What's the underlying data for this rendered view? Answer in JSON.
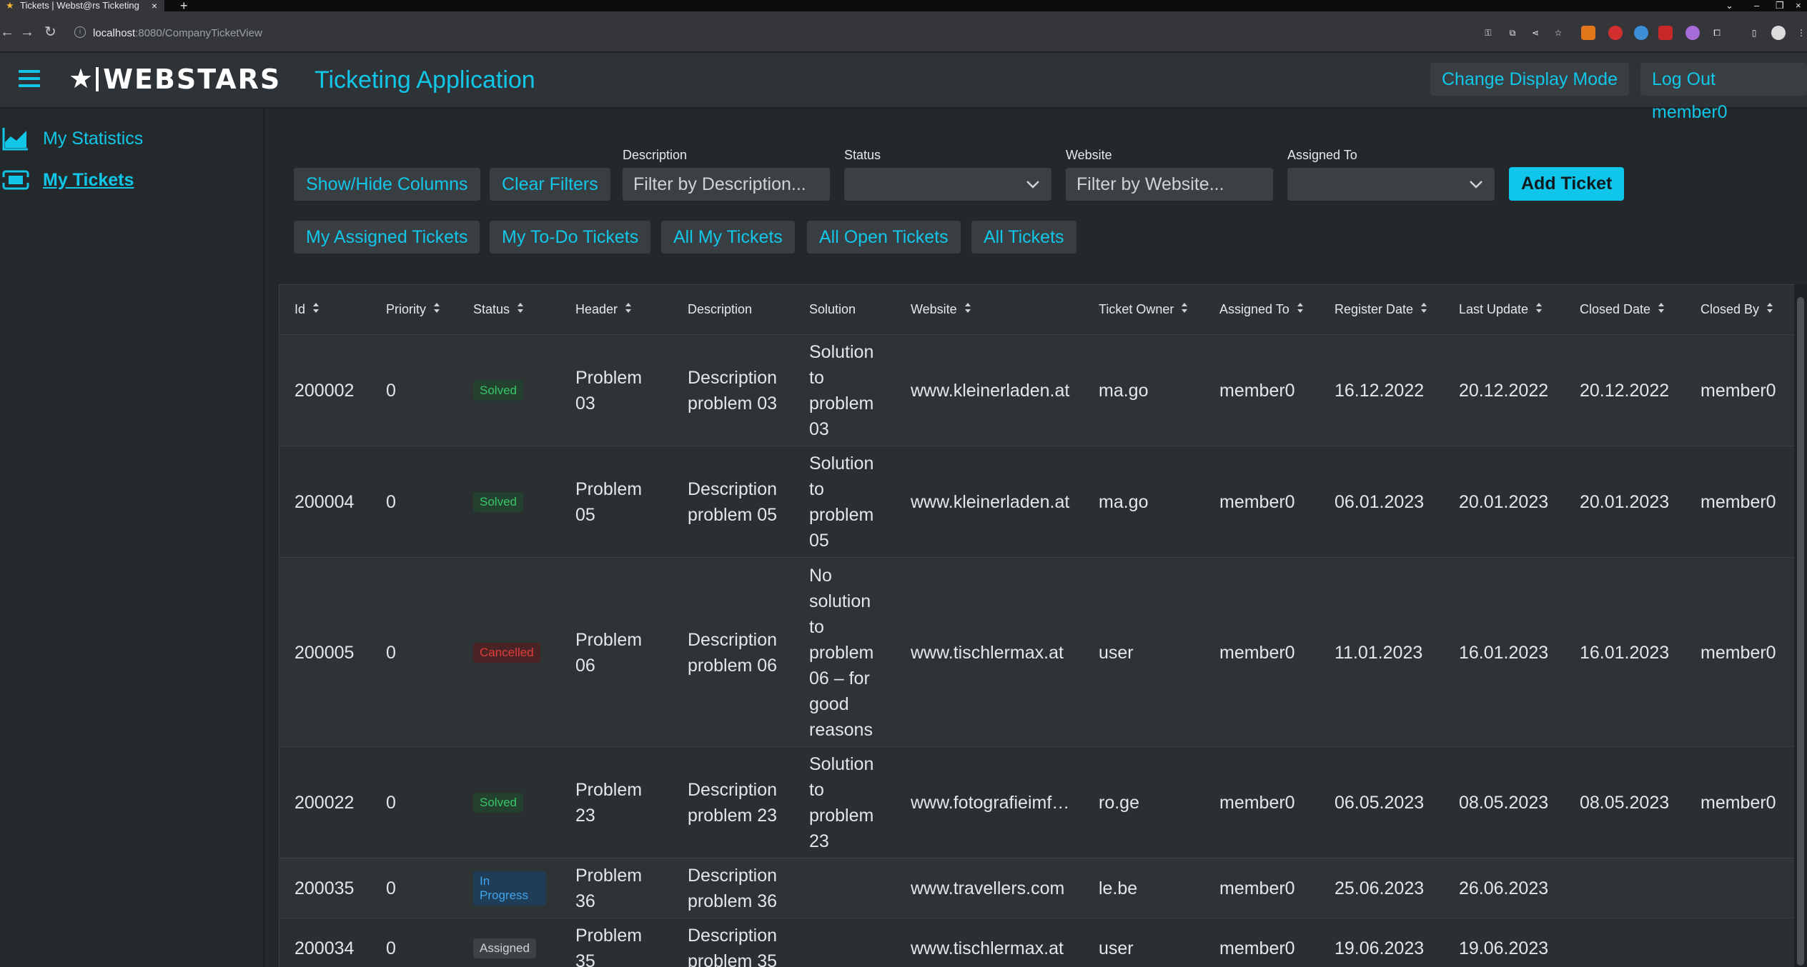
{
  "browser": {
    "tab_title": "Tickets | Webst@rs Ticketing",
    "url_host": "localhost",
    "url_rest": ":8080/CompanyTicketView"
  },
  "header": {
    "logo_text": "WEBSTARS",
    "app_title": "Ticketing Application",
    "display_mode_label": "Change Display Mode",
    "logout_label": "Log Out member0",
    "accent_color": "#12c6e8"
  },
  "sidebar": {
    "items": [
      {
        "label": "My Statistics",
        "icon": "chart-area-icon"
      },
      {
        "label": "My Tickets",
        "icon": "ticket-icon"
      }
    ]
  },
  "filters": {
    "show_hide_label": "Show/Hide Columns",
    "clear_label": "Clear Filters",
    "description_label": "Description",
    "description_placeholder": "Filter by Description...",
    "status_label": "Status",
    "website_label": "Website",
    "website_placeholder": "Filter by Website...",
    "assigned_label": "Assigned To",
    "add_ticket_label": "Add Ticket"
  },
  "quick_filters": [
    "My Assigned Tickets",
    "My To-Do Tickets",
    "All My Tickets",
    "All Open Tickets",
    "All Tickets"
  ],
  "table": {
    "columns": [
      "Id",
      "Priority",
      "Status",
      "Header",
      "Description",
      "Solution",
      "Website",
      "Ticket Owner",
      "Assigned To",
      "Register Date",
      "Last Update",
      "Closed Date",
      "Closed By"
    ],
    "rows": [
      {
        "id": "200002",
        "priority": "0",
        "status": "Solved",
        "header": [
          "Problem",
          "03"
        ],
        "description": [
          "Description",
          "problem 03"
        ],
        "solution": [
          "Solution",
          "to",
          "problem",
          "03"
        ],
        "website": "www.kleinerladen.at",
        "owner": "ma.go",
        "assigned": "member0",
        "registered": "16.12.2022",
        "updated": "20.12.2022",
        "closed": "20.12.2022",
        "closed_by": "member0"
      },
      {
        "id": "200004",
        "priority": "0",
        "status": "Solved",
        "header": [
          "Problem",
          "05"
        ],
        "description": [
          "Description",
          "problem 05"
        ],
        "solution": [
          "Solution",
          "to",
          "problem",
          "05"
        ],
        "website": "www.kleinerladen.at",
        "owner": "ma.go",
        "assigned": "member0",
        "registered": "06.01.2023",
        "updated": "20.01.2023",
        "closed": "20.01.2023",
        "closed_by": "member0"
      },
      {
        "id": "200005",
        "priority": "0",
        "status": "Cancelled",
        "header": [
          "Problem",
          "06"
        ],
        "description": [
          "Description",
          "problem 06"
        ],
        "solution": [
          "No",
          "solution",
          "to",
          "problem",
          "06 – for",
          "good",
          "reasons"
        ],
        "website": "www.tischlermax.at",
        "owner": "user",
        "assigned": "member0",
        "registered": "11.01.2023",
        "updated": "16.01.2023",
        "closed": "16.01.2023",
        "closed_by": "member0"
      },
      {
        "id": "200022",
        "priority": "0",
        "status": "Solved",
        "header": [
          "Problem",
          "23"
        ],
        "description": [
          "Description",
          "problem 23"
        ],
        "solution": [
          "Solution",
          "to",
          "problem",
          "23"
        ],
        "website": "www.fotografieimf…",
        "owner": "ro.ge",
        "assigned": "member0",
        "registered": "06.05.2023",
        "updated": "08.05.2023",
        "closed": "08.05.2023",
        "closed_by": "member0"
      },
      {
        "id": "200035",
        "priority": "0",
        "status": "In Progress",
        "header": [
          "Problem",
          "36"
        ],
        "description": [
          "Description",
          "problem 36"
        ],
        "solution": [],
        "website": "www.travellers.com",
        "owner": "le.be",
        "assigned": "member0",
        "registered": "25.06.2023",
        "updated": "26.06.2023",
        "closed": "",
        "closed_by": ""
      },
      {
        "id": "200034",
        "priority": "0",
        "status": "Assigned",
        "header": [
          "Problem",
          "35"
        ],
        "description": [
          "Description",
          "problem 35"
        ],
        "solution": [],
        "website": "www.tischlermax.at",
        "owner": "user",
        "assigned": "member0",
        "registered": "19.06.2023",
        "updated": "19.06.2023",
        "closed": "",
        "closed_by": ""
      }
    ]
  }
}
